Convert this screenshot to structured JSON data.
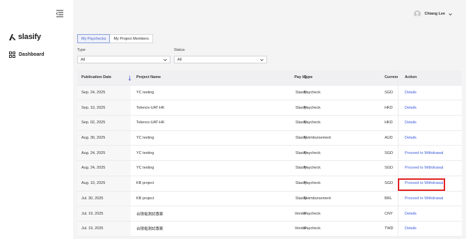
{
  "brand": {
    "name": "slasify"
  },
  "sidebar": {
    "items": [
      {
        "label": "Dashboard",
        "icon": "dashboard-grid-icon"
      }
    ]
  },
  "user": {
    "name": "Chiang Lee"
  },
  "tabs": [
    {
      "label": "My Paychecks",
      "active": true
    },
    {
      "label": "My Project Members",
      "active": false
    }
  ],
  "filters": {
    "type": {
      "label": "Type",
      "value": "All"
    },
    "status": {
      "label": "Status",
      "value": "All"
    }
  },
  "table": {
    "headers": {
      "date": "Publication Date",
      "project": "Project Name",
      "pay_by": "Pay by",
      "type": "Type",
      "currency": "Currency",
      "action": "Action"
    },
    "rows": [
      {
        "date": "Sep. 24, 2025",
        "project": "YC testing",
        "pay_by": "Slasify",
        "type": "Paycheck",
        "currency": "SGD",
        "action": "Details"
      },
      {
        "date": "Sep. 10, 2025",
        "project": "Telenox-UAT-HK",
        "pay_by": "Slasify",
        "type": "Paycheck",
        "currency": "HKD",
        "action": "Details"
      },
      {
        "date": "Sep. 02, 2025",
        "project": "Telenox-UAT-HK",
        "pay_by": "Slasify",
        "type": "Paycheck",
        "currency": "HKD",
        "action": "Details"
      },
      {
        "date": "Aug. 30, 2025",
        "project": "YC testing",
        "pay_by": "Slasify",
        "type": "Reimbursement",
        "currency": "AUD",
        "action": "Details"
      },
      {
        "date": "Aug. 24, 2025",
        "project": "YC testing",
        "pay_by": "Slasify",
        "type": "Paycheck",
        "currency": "SGD",
        "action": "Proceed to Withdrawal"
      },
      {
        "date": "Aug. 24, 2025",
        "project": "YC testing",
        "pay_by": "Slasify",
        "type": "Paycheck",
        "currency": "SGD",
        "action": "Proceed to Withdrawal"
      },
      {
        "date": "Aug. 10, 2025",
        "project": "KB project",
        "pay_by": "Slasify",
        "type": "Paycheck",
        "currency": "SGD",
        "action": "Proceed to Withdrawal"
      },
      {
        "date": "Jul. 30, 2025",
        "project": "KB project",
        "pay_by": "Slasify",
        "type": "Reimbursement",
        "currency": "BRL",
        "action": "Proceed to Withdrawal"
      },
      {
        "date": "Jul. 19, 2025",
        "project": "台積電測試專案",
        "pay_by": "Vendor",
        "type": "Paycheck",
        "currency": "CNY",
        "action": "Details"
      },
      {
        "date": "Jul. 19, 2025",
        "project": "台積電測試專案",
        "pay_by": "Vendor",
        "type": "Paycheck",
        "currency": "TWD",
        "action": "Details"
      }
    ]
  },
  "colors": {
    "link": "#3b5bdb",
    "highlight": "#e02020",
    "active_tab": "#4a66c4"
  }
}
